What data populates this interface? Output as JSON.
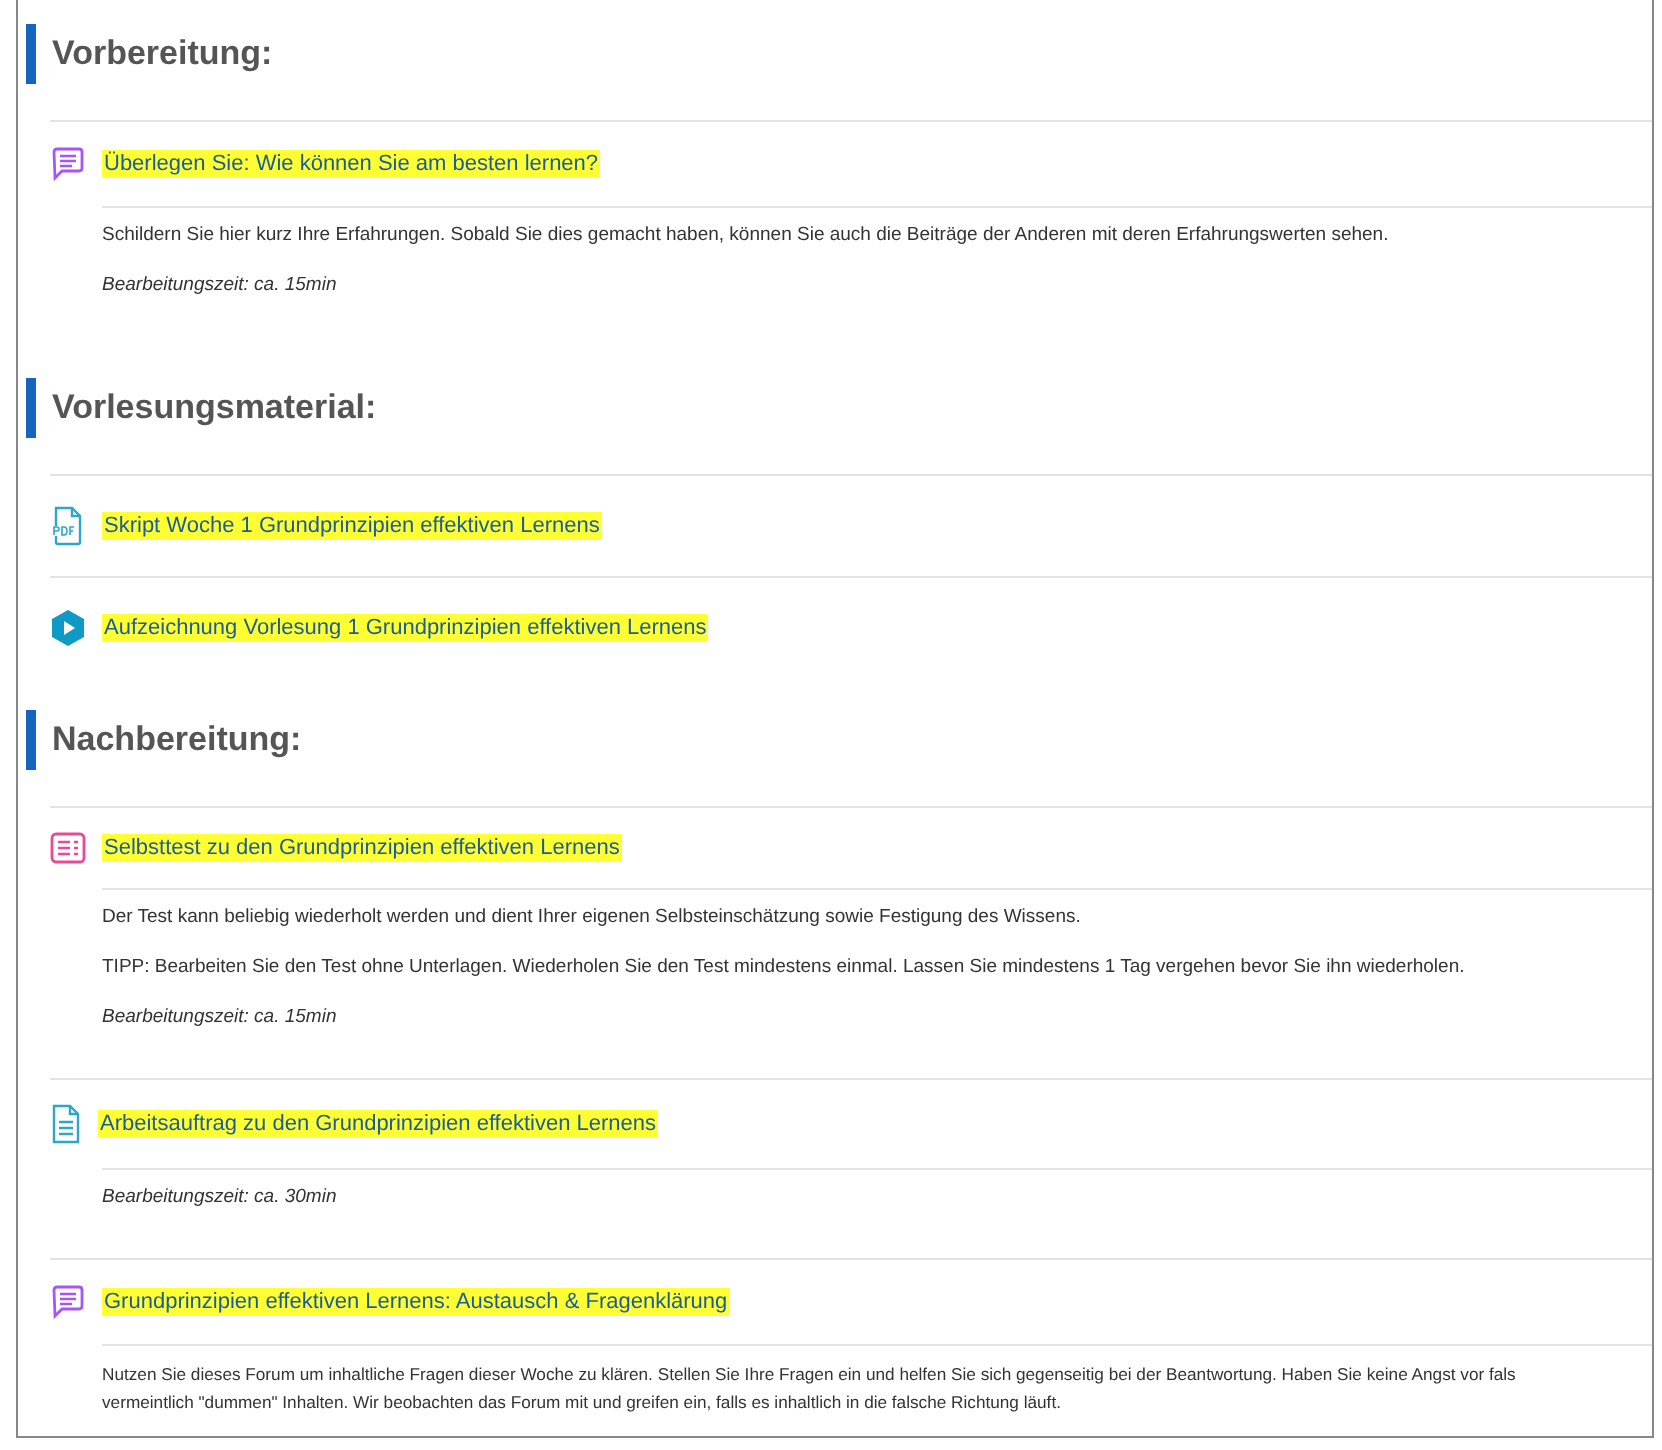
{
  "sections": [
    {
      "title": "Vorbereitung:",
      "items": [
        {
          "kind": "forum",
          "title": "Überlegen Sie: Wie können Sie am besten lernen?",
          "highlighted": true,
          "paragraphs": [
            "Schildern Sie hier kurz Ihre Erfahrungen. Sobald Sie dies gemacht haben, können Sie auch die Beiträge der Anderen mit deren Erfahrungswerten sehen."
          ],
          "time": "Bearbeitungszeit: ca. 15min"
        }
      ]
    },
    {
      "title": "Vorlesungsmaterial:",
      "items": [
        {
          "kind": "pdf",
          "title": "Skript Woche 1 Grundprinzipien effektiven Lernens",
          "highlighted": true
        },
        {
          "kind": "video",
          "title": "Aufzeichnung Vorlesung 1 Grundprinzipien effektiven Lernens",
          "highlighted": true
        }
      ]
    },
    {
      "title": "Nachbereitung:",
      "items": [
        {
          "kind": "quiz",
          "title": "Selbsttest zu den Grundprinzipien effektiven Lernens",
          "highlighted": true,
          "paragraphs": [
            "Der Test kann beliebig wiederholt werden und dient Ihrer eigenen Selbsteinschätzung sowie Festigung des Wissens.",
            "TIPP: Bearbeiten Sie den Test ohne Unterlagen. Wiederholen Sie den Test mindestens einmal. Lassen Sie mindestens 1 Tag vergehen bevor Sie ihn wiederholen."
          ],
          "time": "Bearbeitungszeit: ca. 15min"
        },
        {
          "kind": "page",
          "title": "Arbeitsauftrag zu den Grundprinzipien effektiven Lernens",
          "highlighted": true,
          "time": "Bearbeitungszeit: ca. 30min"
        },
        {
          "kind": "forum",
          "title": "Grundprinzipien effektiven Lernens: Austausch & Fragenklärung",
          "highlighted": true,
          "lines": [
            "Nutzen Sie dieses Forum um inhaltliche Fragen dieser Woche zu klären. Stellen Sie Ihre Fragen ein und helfen Sie sich gegenseitig bei der Beantwortung. Haben Sie keine Angst vor fals",
            "vermeintlich \"dummen\" Inhalten. Wir beobachten das Forum mit und greifen ein, falls es inhaltlich in die falsche Richtung läuft."
          ]
        }
      ]
    }
  ]
}
